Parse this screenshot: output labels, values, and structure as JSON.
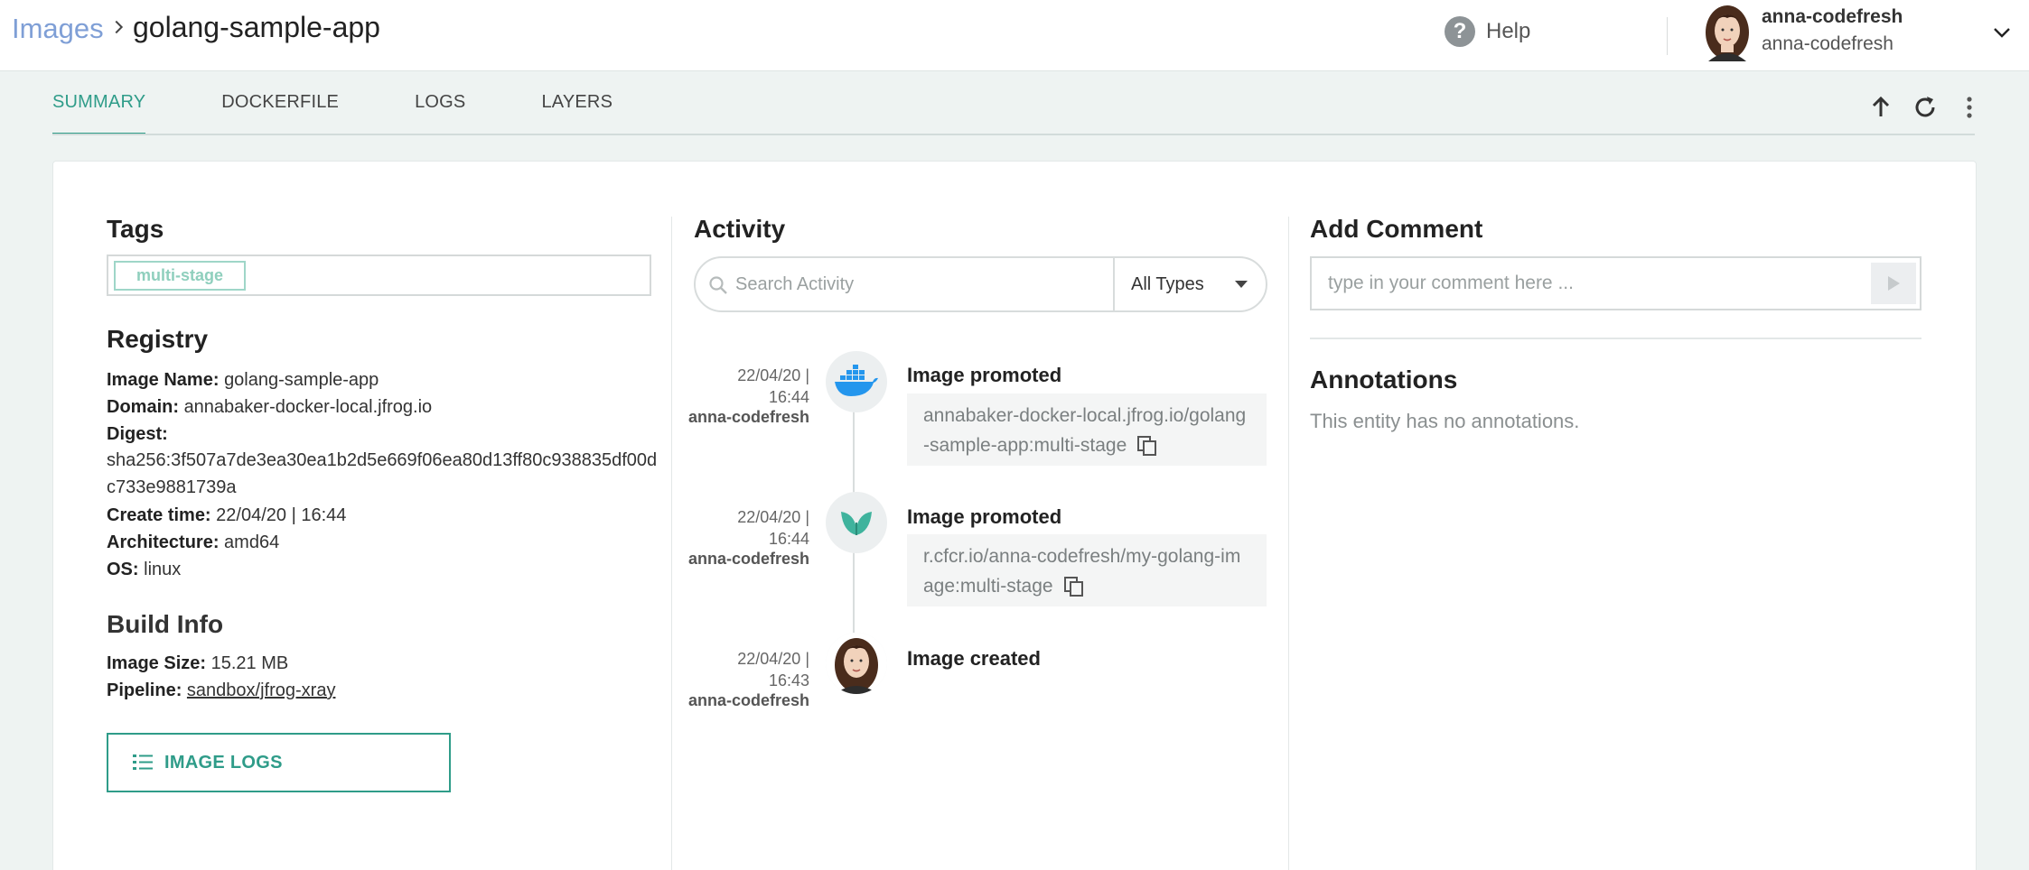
{
  "header": {
    "breadcrumb_root": "Images",
    "title": "golang-sample-app",
    "help_label": "Help",
    "user_name": "anna-codefresh",
    "user_account": "anna-codefresh"
  },
  "tabs": [
    {
      "label": "SUMMARY",
      "active": true
    },
    {
      "label": "DOCKERFILE",
      "active": false
    },
    {
      "label": "LOGS",
      "active": false
    },
    {
      "label": "LAYERS",
      "active": false
    }
  ],
  "toolbar": {
    "icons": [
      "arrow-up-icon",
      "refresh-icon",
      "kebab-menu-icon"
    ]
  },
  "tags": {
    "title": "Tags",
    "items": [
      "multi-stage"
    ]
  },
  "registry": {
    "title": "Registry",
    "image_name_label": "Image Name:",
    "image_name": "golang-sample-app",
    "domain_label": "Domain:",
    "domain": "annabaker-docker-local.jfrog.io",
    "digest_label": "Digest:",
    "digest": "sha256:3f507a7de3ea30ea1b2d5e669f06ea80d13ff80c938835df00dc733e9881739a",
    "create_time_label": "Create time:",
    "create_time": "22/04/20 | 16:44",
    "architecture_label": "Architecture:",
    "architecture": "amd64",
    "os_label": "OS:",
    "os": "linux"
  },
  "build_info": {
    "title": "Build Info",
    "image_size_label": "Image Size:",
    "image_size": "15.21 MB",
    "pipeline_label": "Pipeline:",
    "pipeline": "sandbox/jfrog-xray",
    "logs_button": "IMAGE LOGS"
  },
  "activity": {
    "title": "Activity",
    "search_placeholder": "Search Activity",
    "type_filter": "All Types",
    "events": [
      {
        "date": "22/04/20 |",
        "time": "16:44",
        "user": "anna-codefresh",
        "title": "Image promoted",
        "detail": "annabaker-docker-local.jfrog.io/golang-sample-app:multi-stage",
        "icon": "docker-icon"
      },
      {
        "date": "22/04/20 |",
        "time": "16:44",
        "user": "anna-codefresh",
        "title": "Image promoted",
        "detail": "r.cfcr.io/anna-codefresh/my-golang-image:multi-stage",
        "icon": "codefresh-leaf-icon"
      },
      {
        "date": "22/04/20 |",
        "time": "16:43",
        "user": "anna-codefresh",
        "title": "Image created",
        "detail": "",
        "icon": "user-avatar"
      }
    ]
  },
  "comments": {
    "title": "Add Comment",
    "placeholder": "type in your comment here ..."
  },
  "annotations": {
    "title": "Annotations",
    "empty_text": "This entity has no annotations."
  },
  "colors": {
    "accent": "#2f9c89",
    "breadcrumb": "#7f9fd6",
    "docker_blue": "#2496ed",
    "leaf_green": "#3fb39d"
  }
}
